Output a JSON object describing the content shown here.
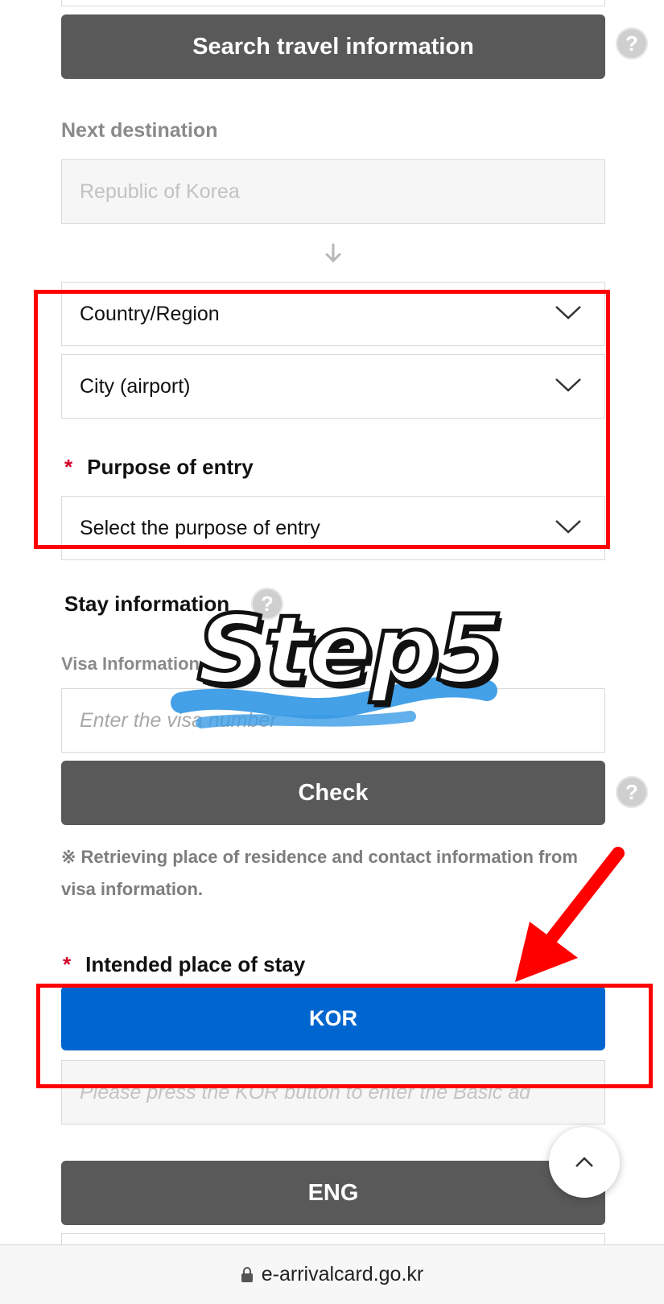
{
  "search_button": {
    "label": "Search travel information"
  },
  "next_destination": {
    "label": "Next destination",
    "value": "Republic of Korea"
  },
  "country_select": {
    "value": "Country/Region"
  },
  "city_select": {
    "value": "City (airport)"
  },
  "purpose": {
    "required_mark": "*",
    "label": "Purpose of entry",
    "select_value": "Select the purpose of entry"
  },
  "stay_info": {
    "label": "Stay information"
  },
  "visa": {
    "label": "Visa Information",
    "placeholder": "Enter the visa number",
    "check_label": "Check",
    "note": "※ Retrieving place of residence and contact information from visa information."
  },
  "intended_stay": {
    "required_mark": "*",
    "label": "Intended place of stay",
    "kor_label": "KOR",
    "address_placeholder": "Please press the KOR button to enter the Basic ad",
    "eng_label": "ENG"
  },
  "overlay": {
    "step_text": "Step5"
  },
  "browser": {
    "url": "e-arrivalcard.go.kr"
  },
  "colors": {
    "dark_button": "#595959",
    "blue_button": "#0066cf",
    "highlight_red": "#ff0000",
    "required_red": "#d0002a",
    "brush_blue": "#3a9be6"
  }
}
